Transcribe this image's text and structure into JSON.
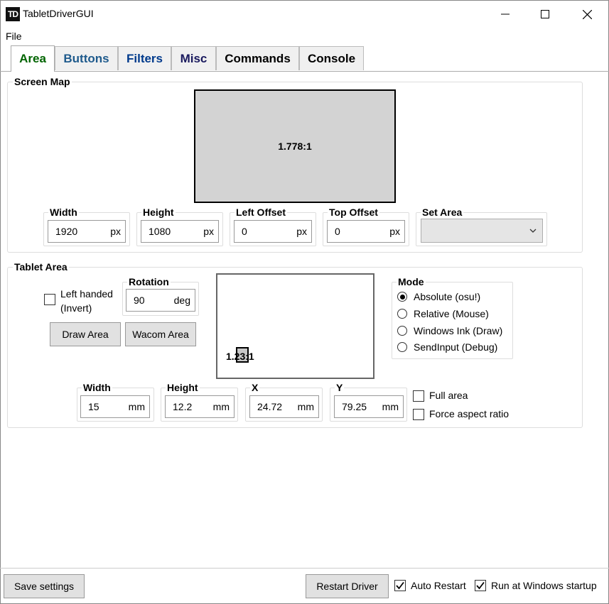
{
  "window": {
    "icon_text": "TD",
    "title": "TabletDriverGUI"
  },
  "menu": {
    "file": "File"
  },
  "tabs": [
    {
      "label": "Area",
      "color": "#006400"
    },
    {
      "label": "Buttons",
      "color": "#1e5a8c"
    },
    {
      "label": "Filters",
      "color": "#003a8c"
    },
    {
      "label": "Misc",
      "color": "#1a1a5e"
    },
    {
      "label": "Commands",
      "color": "#000000"
    },
    {
      "label": "Console",
      "color": "#000000"
    }
  ],
  "screen_map": {
    "title": "Screen Map",
    "aspect": "1.778:1",
    "width": {
      "label": "Width",
      "value": "1920",
      "unit": "px"
    },
    "height": {
      "label": "Height",
      "value": "1080",
      "unit": "px"
    },
    "left_offset": {
      "label": "Left Offset",
      "value": "0",
      "unit": "px"
    },
    "top_offset": {
      "label": "Top Offset",
      "value": "0",
      "unit": "px"
    },
    "set_area": {
      "label": "Set Area",
      "value": ""
    }
  },
  "tablet_area": {
    "title": "Tablet Area",
    "left_handed_line1": "Left handed",
    "left_handed_line2": "(Invert)",
    "left_handed_checked": false,
    "rotation": {
      "label": "Rotation",
      "value": "90",
      "unit": "deg"
    },
    "draw_area": "Draw Area",
    "wacom_area": "Wacom Area",
    "aspect": "1.23:1",
    "width": {
      "label": "Width",
      "value": "15",
      "unit": "mm"
    },
    "height": {
      "label": "Height",
      "value": "12.2",
      "unit": "mm"
    },
    "x": {
      "label": "X",
      "value": "24.72",
      "unit": "mm"
    },
    "y": {
      "label": "Y",
      "value": "79.25",
      "unit": "mm"
    },
    "full_area": "Full area",
    "full_area_checked": false,
    "force_aspect": "Force aspect ratio",
    "force_aspect_checked": false,
    "mode": {
      "title": "Mode",
      "options": [
        "Absolute (osu!)",
        "Relative (Mouse)",
        "Windows Ink (Draw)",
        "SendInput (Debug)"
      ],
      "selected": 0
    }
  },
  "bottom": {
    "save": "Save settings",
    "restart": "Restart Driver",
    "auto_restart": "Auto Restart",
    "auto_restart_checked": true,
    "run_startup": "Run at Windows startup",
    "run_startup_checked": true
  }
}
